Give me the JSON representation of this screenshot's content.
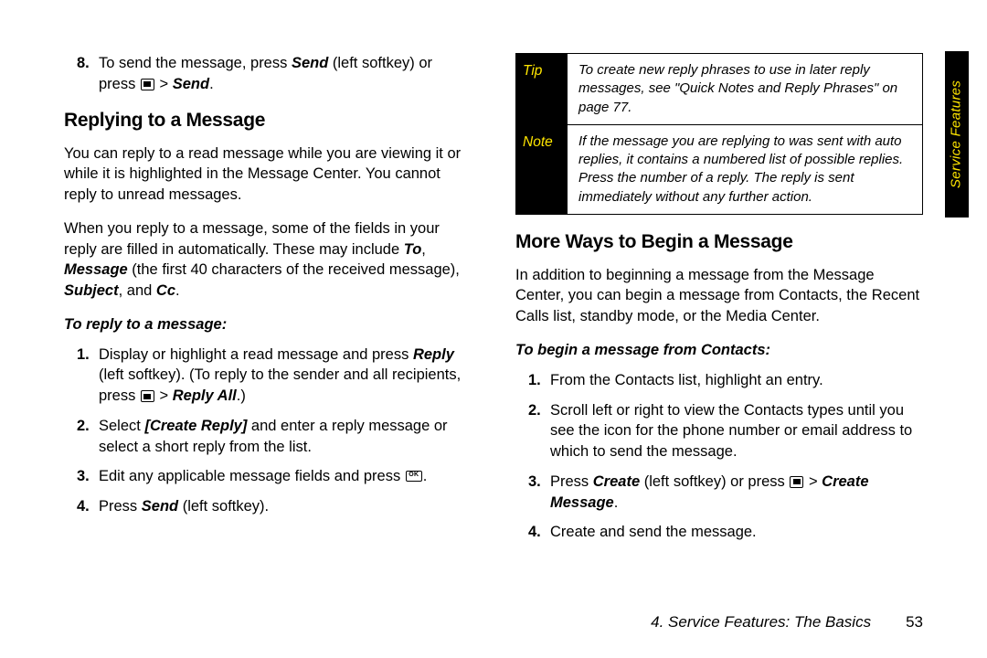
{
  "leftCol": {
    "step8": {
      "num": "8.",
      "pre": "To send the message, press ",
      "bi1": "Send",
      "mid1": " (left softkey) or press ",
      "post": " > ",
      "bi2": "Send",
      "tail": "."
    },
    "h_reply": "Replying to a Message",
    "p1": "You can reply to a read message while you are viewing it or while it is highlighted in the Message Center. You cannot reply to unread messages.",
    "p2_pre": "When you reply to a message, some of the fields in your reply are filled in automatically. These may include ",
    "p2_to": "To",
    "p2_c1": ", ",
    "p2_msg": "Message",
    "p2_mid": " (the first 40 characters of the received message), ",
    "p2_subj": "Subject",
    "p2_c2": ", and ",
    "p2_cc": "Cc",
    "p2_tail": ".",
    "lead1": "To reply to a message:",
    "steps": [
      {
        "num": "1.",
        "pre": "Display or highlight a read message and press ",
        "bi1": "Reply",
        "mid": " (left softkey). (To reply to the sender and all recipients, press ",
        "post": " > ",
        "bi2": "Reply All",
        "tail": ".)"
      },
      {
        "num": "2.",
        "pre": "Select ",
        "bi1": "[Create Reply]",
        "mid": " and enter a reply message or select a short reply from the list.",
        "post": "",
        "bi2": "",
        "tail": ""
      },
      {
        "num": "3.",
        "pre": "Edit any applicable message fields and press ",
        "bi1": "",
        "mid": "",
        "post": "",
        "bi2": "",
        "tail": "."
      },
      {
        "num": "4.",
        "pre": "Press ",
        "bi1": "Send",
        "mid": " (left softkey).",
        "post": "",
        "bi2": "",
        "tail": ""
      }
    ]
  },
  "rightCol": {
    "tip": {
      "label": "Tip",
      "body": "To create new reply phrases to use in later reply messages, see \"Quick Notes and Reply Phrases\" on page 77."
    },
    "note": {
      "label": "Note",
      "body": "If the message you are replying to was sent with auto replies, it contains a numbered list of possible replies. Press the number of a reply. The reply is sent immediately without any further action."
    },
    "h_more": "More Ways to Begin a Message",
    "p1": "In addition to beginning a message from the Message Center, you can begin a message from Contacts, the Recent Calls list, standby mode, or the Media Center.",
    "lead1": "To begin a message from Contacts:",
    "steps": [
      {
        "num": "1.",
        "pre": "From the Contacts list, highlight an entry.",
        "bi1": "",
        "mid": "",
        "post": "",
        "bi2": "",
        "tail": ""
      },
      {
        "num": "2.",
        "pre": "Scroll left or right to view the Contacts types until you see the icon for the phone number or email address to which to send the message.",
        "bi1": "",
        "mid": "",
        "post": "",
        "bi2": "",
        "tail": ""
      },
      {
        "num": "3.",
        "pre": "Press ",
        "bi1": "Create",
        "mid": " (left softkey) or press ",
        "post": " > ",
        "bi2": "Create Message",
        "tail": "."
      },
      {
        "num": "4.",
        "pre": "Create and send the message.",
        "bi1": "",
        "mid": "",
        "post": "",
        "bi2": "",
        "tail": ""
      }
    ]
  },
  "sideTab": "Service Features",
  "footer": {
    "section": "4. Service Features: The Basics",
    "page": "53"
  }
}
